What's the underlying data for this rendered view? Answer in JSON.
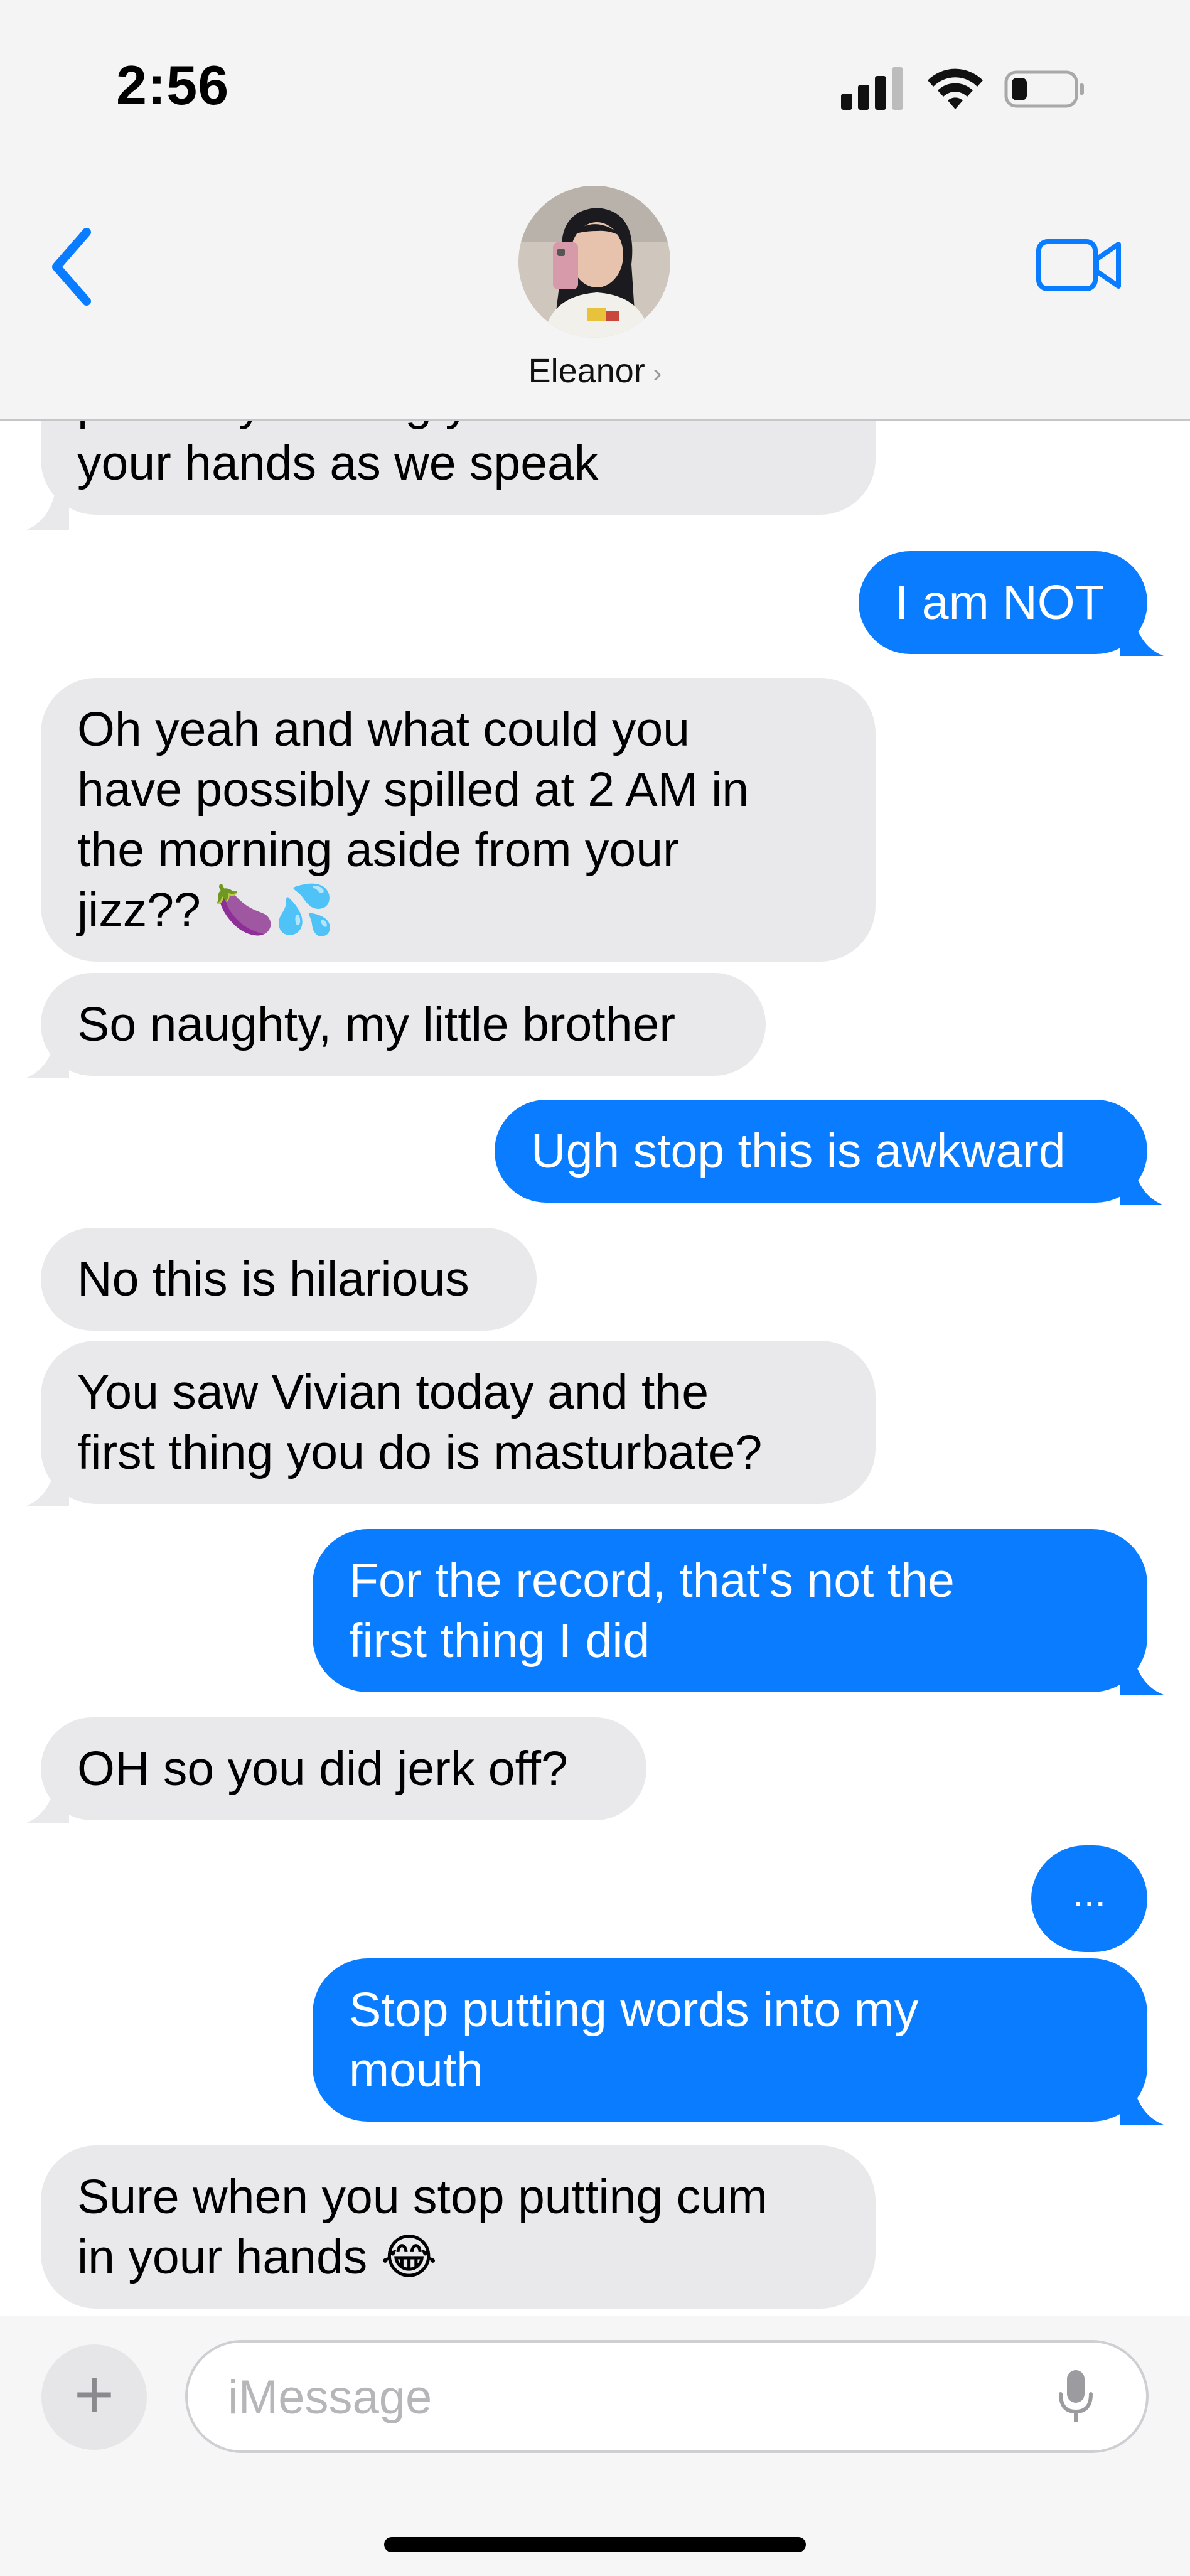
{
  "status_bar": {
    "time": "2:56",
    "battery_level": 0.25
  },
  "header": {
    "contact_name": "Eleanor",
    "chevron": "›"
  },
  "messages": [
    {
      "dir": "in",
      "text": "probably holding your cum in\nyour hands as we speak"
    },
    {
      "dir": "out",
      "text": "I am NOT"
    },
    {
      "dir": "in",
      "text": "Oh yeah and what could you\nhave possibly spilled at 2 AM in\nthe morning aside from your\njizz?? 🍆💦"
    },
    {
      "dir": "in",
      "text": "So naughty, my little brother"
    },
    {
      "dir": "out",
      "text": "Ugh stop this is awkward"
    },
    {
      "dir": "in",
      "text": "No this is hilarious"
    },
    {
      "dir": "in",
      "text": "You saw Vivian today and the\nfirst thing you do is masturbate?"
    },
    {
      "dir": "out",
      "text": "For the record, that's not the\nfirst thing I did"
    },
    {
      "dir": "in",
      "text": "OH so you did jerk off?"
    },
    {
      "dir": "out",
      "text": "..."
    },
    {
      "dir": "out",
      "text": "Stop putting words into my\nmouth"
    },
    {
      "dir": "in",
      "text": "Sure when you stop putting cum\nin your hands 😂"
    }
  ],
  "input": {
    "placeholder": "iMessage",
    "add_label": "+"
  },
  "colors": {
    "outgoing": "#0a7cff",
    "incoming": "#e9e9eb",
    "accent": "#0a7cff"
  },
  "icons": [
    "back-chevron-icon",
    "video-call-icon",
    "plus-icon",
    "microphone-icon",
    "cellular-signal-icon",
    "wifi-icon",
    "battery-icon"
  ]
}
